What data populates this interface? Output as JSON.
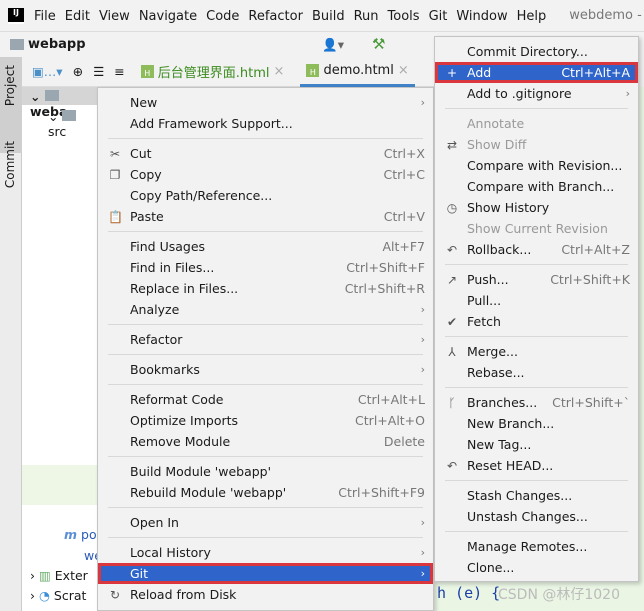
{
  "menubar": {
    "logo": "IJ",
    "items": [
      "File",
      "Edit",
      "View",
      "Navigate",
      "Code",
      "Refactor",
      "Build",
      "Run",
      "Tools",
      "Git",
      "Window",
      "Help"
    ],
    "window_title": "webdemo -"
  },
  "navbar": {
    "project": "webapp"
  },
  "sidebar": {
    "project_tab": "Project",
    "commit_tab": "Commit"
  },
  "tabs": [
    {
      "label": "后台管理界面.html",
      "color": "#3b8b1e"
    },
    {
      "label": "demo.html",
      "color": "#1a1a1a"
    }
  ],
  "tree": {
    "items": [
      "weba",
      "src",
      "po",
      "we",
      "Exter",
      "Scrat"
    ]
  },
  "context_menu": [
    {
      "label": "New",
      "arrow": true
    },
    {
      "label": "Add Framework Support..."
    },
    {
      "sep": true
    },
    {
      "label": "Cut",
      "shortcut": "Ctrl+X",
      "icon": "scissors-icon",
      "glyph": "✂"
    },
    {
      "label": "Copy",
      "shortcut": "Ctrl+C",
      "icon": "copy-icon",
      "glyph": "❐"
    },
    {
      "label": "Copy Path/Reference..."
    },
    {
      "label": "Paste",
      "shortcut": "Ctrl+V",
      "icon": "paste-icon",
      "glyph": "📋"
    },
    {
      "sep": true
    },
    {
      "label": "Find Usages",
      "shortcut": "Alt+F7"
    },
    {
      "label": "Find in Files...",
      "shortcut": "Ctrl+Shift+F"
    },
    {
      "label": "Replace in Files...",
      "shortcut": "Ctrl+Shift+R"
    },
    {
      "label": "Analyze",
      "arrow": true
    },
    {
      "sep": true
    },
    {
      "label": "Refactor",
      "arrow": true
    },
    {
      "sep": true
    },
    {
      "label": "Bookmarks",
      "arrow": true
    },
    {
      "sep": true
    },
    {
      "label": "Reformat Code",
      "shortcut": "Ctrl+Alt+L"
    },
    {
      "label": "Optimize Imports",
      "shortcut": "Ctrl+Alt+O"
    },
    {
      "label": "Remove Module",
      "shortcut": "Delete"
    },
    {
      "sep": true
    },
    {
      "label": "Build Module 'webapp'"
    },
    {
      "label": "Rebuild Module 'webapp'",
      "shortcut": "Ctrl+Shift+F9"
    },
    {
      "sep": true
    },
    {
      "label": "Open In",
      "arrow": true
    },
    {
      "sep": true
    },
    {
      "label": "Local History",
      "arrow": true
    },
    {
      "label": "Git",
      "arrow": true,
      "highlighted": true
    },
    {
      "label": "Reload from Disk",
      "icon": "reload-icon",
      "glyph": "↻"
    }
  ],
  "git_submenu": [
    {
      "label": "Commit Directory..."
    },
    {
      "label": "Add",
      "shortcut": "Ctrl+Alt+A",
      "icon": "plus-icon",
      "glyph": "+",
      "highlighted": true
    },
    {
      "label": "Add to .gitignore",
      "arrow": true
    },
    {
      "sep": true
    },
    {
      "label": "Annotate",
      "disabled": true
    },
    {
      "label": "Show Diff",
      "disabled": true,
      "icon": "diff-icon",
      "glyph": "⇄"
    },
    {
      "label": "Compare with Revision..."
    },
    {
      "label": "Compare with Branch..."
    },
    {
      "label": "Show History",
      "icon": "clock-icon",
      "glyph": "◷"
    },
    {
      "label": "Show Current Revision",
      "disabled": true
    },
    {
      "label": "Rollback...",
      "shortcut": "Ctrl+Alt+Z",
      "icon": "rollback-icon",
      "glyph": "↶"
    },
    {
      "sep": true
    },
    {
      "label": "Push...",
      "shortcut": "Ctrl+Shift+K",
      "icon": "push-icon",
      "glyph": "↗"
    },
    {
      "label": "Pull..."
    },
    {
      "label": "Fetch",
      "icon": "fetch-icon",
      "glyph": "✔"
    },
    {
      "sep": true
    },
    {
      "label": "Merge...",
      "icon": "merge-icon",
      "glyph": "⅄"
    },
    {
      "label": "Rebase..."
    },
    {
      "sep": true
    },
    {
      "label": "Branches...",
      "shortcut": "Ctrl+Shift+`",
      "icon": "branch-icon",
      "glyph": "ᚴ"
    },
    {
      "label": "New Branch..."
    },
    {
      "label": "New Tag..."
    },
    {
      "label": "Reset HEAD...",
      "icon": "reset-icon",
      "glyph": "↶"
    },
    {
      "sep": true
    },
    {
      "label": "Stash Changes..."
    },
    {
      "label": "Unstash Changes..."
    },
    {
      "sep": true
    },
    {
      "label": "Manage Remotes..."
    },
    {
      "label": "Clone..."
    }
  ],
  "editor": {
    "code_fragment": "h (e) {"
  },
  "watermark": "CSDN @林仔1020"
}
